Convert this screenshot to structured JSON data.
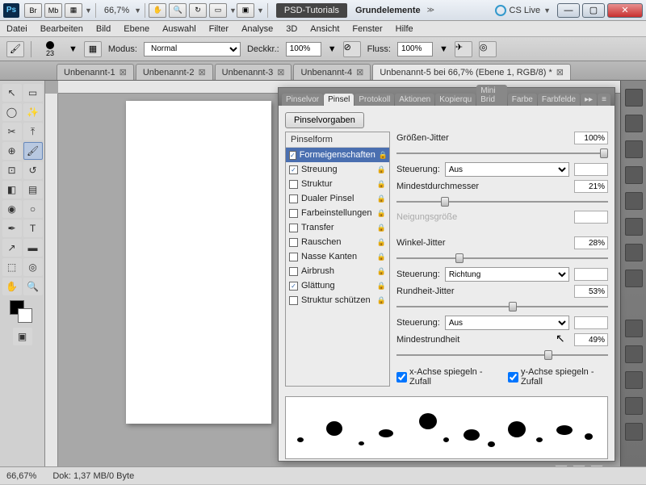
{
  "title": {
    "ps": "Ps",
    "br": "Br",
    "mb": "Mb",
    "zoom": "66,7%",
    "psdtut": "PSD-Tutorials",
    "grunde": "Grundelemente",
    "cslive": "CS Live"
  },
  "menu": [
    "Datei",
    "Bearbeiten",
    "Bild",
    "Ebene",
    "Auswahl",
    "Filter",
    "Analyse",
    "3D",
    "Ansicht",
    "Fenster",
    "Hilfe"
  ],
  "options": {
    "brush_size": "23",
    "modus_lbl": "Modus:",
    "modus_val": "Normal",
    "deckk_lbl": "Deckkr.:",
    "deckk_val": "100%",
    "fluss_lbl": "Fluss:",
    "fluss_val": "100%"
  },
  "tabs": {
    "t1": "Unbenannt-1",
    "t2": "Unbenannt-2",
    "t3": "Unbenannt-3",
    "t4": "Unbenannt-4",
    "t5": "Unbenannt-5 bei 66,7% (Ebene 1, RGB/8) *"
  },
  "panel_tabs": [
    "Pinselvor",
    "Pinsel",
    "Protokoll",
    "Aktionen",
    "Kopierqu",
    "Mini Brid",
    "Farbe",
    "Farbfelde"
  ],
  "vorgaben": "Pinselvorgaben",
  "shape_hdr": "Pinselform",
  "shapes": [
    {
      "label": "Formeigenschaften",
      "checked": true,
      "sel": true
    },
    {
      "label": "Streuung",
      "checked": true
    },
    {
      "label": "Struktur",
      "checked": false
    },
    {
      "label": "Dualer Pinsel",
      "checked": false
    },
    {
      "label": "Farbeinstellungen",
      "checked": false
    },
    {
      "label": "Transfer",
      "checked": false
    },
    {
      "label": "Rauschen",
      "checked": false
    },
    {
      "label": "Nasse Kanten",
      "checked": false
    },
    {
      "label": "Airbrush",
      "checked": false
    },
    {
      "label": "Glättung",
      "checked": true
    },
    {
      "label": "Struktur schützen",
      "checked": false
    }
  ],
  "settings": {
    "groessen_jitter": "Größen-Jitter",
    "groessen_val": "100%",
    "steuerung": "Steuerung:",
    "aus": "Aus",
    "richtung": "Richtung",
    "mindest": "Mindestdurchmesser",
    "mindest_val": "21%",
    "neigung": "Neigungsgröße",
    "winkel": "Winkel-Jitter",
    "winkel_val": "28%",
    "rundheit": "Rundheit-Jitter",
    "rundheit_val": "53%",
    "mindestrund": "Mindestrundheit",
    "mindestrund_val": "49%",
    "x_mirror": "x-Achse spiegeln - Zufall",
    "y_mirror": "y-Achse spiegeln - Zufall"
  },
  "status": {
    "zoom": "66,67%",
    "dok": "Dok: 1,37 MB/0 Byte"
  }
}
